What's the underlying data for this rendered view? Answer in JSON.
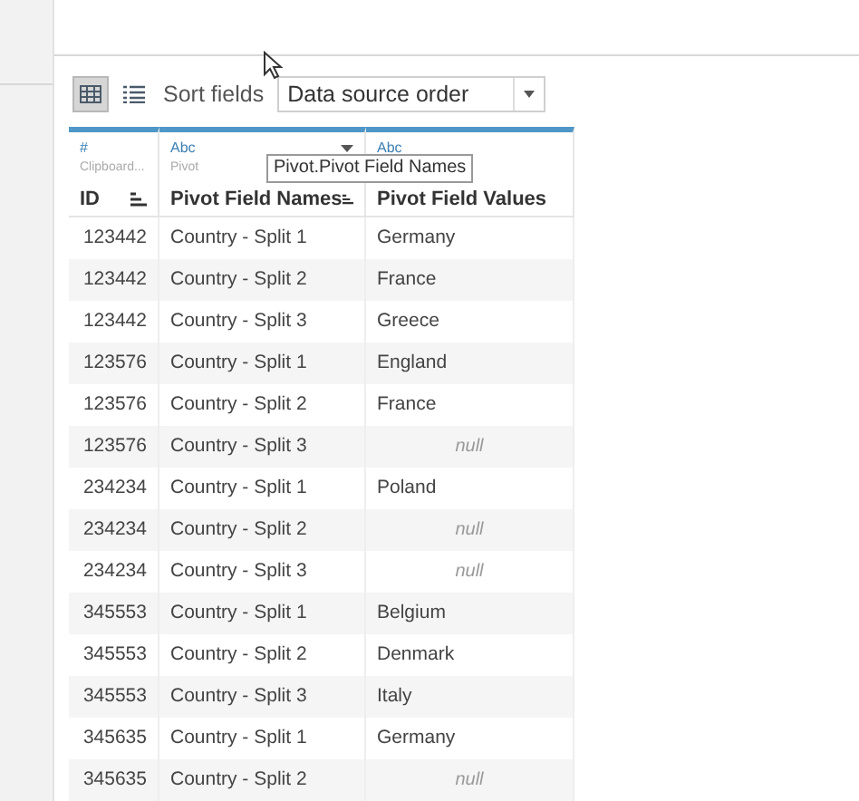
{
  "toolbar": {
    "views": [
      {
        "kind": "grid",
        "selected": true
      },
      {
        "kind": "list",
        "selected": false
      }
    ],
    "sort_label": "Sort fields",
    "sort_value": "Data source order"
  },
  "columns": [
    {
      "type_label": "#",
      "source": "Clipboard...",
      "name": "ID",
      "sort_button": true,
      "menu_caret": false
    },
    {
      "type_label": "Abc",
      "source": "Pivot",
      "name": "Pivot Field Names",
      "sort_button": true,
      "menu_caret": true
    },
    {
      "type_label": "Abc",
      "name": "Pivot Field Values",
      "sort_button": false,
      "menu_caret": false
    }
  ],
  "tooltip": "Pivot.Pivot Field Names",
  "rows": [
    {
      "id": "123442",
      "name": "Country - Split 1",
      "value": {
        "kind": "text",
        "text": "Germany"
      }
    },
    {
      "id": "123442",
      "name": "Country - Split 2",
      "value": {
        "kind": "text",
        "text": "France"
      }
    },
    {
      "id": "123442",
      "name": "Country - Split 3",
      "value": {
        "kind": "text",
        "text": "Greece"
      }
    },
    {
      "id": "123576",
      "name": "Country - Split 1",
      "value": {
        "kind": "text",
        "text": "England"
      }
    },
    {
      "id": "123576",
      "name": "Country - Split 2",
      "value": {
        "kind": "text",
        "text": "France"
      }
    },
    {
      "id": "123576",
      "name": "Country - Split 3",
      "value": {
        "kind": "null",
        "text": "null"
      }
    },
    {
      "id": "234234",
      "name": "Country - Split 1",
      "value": {
        "kind": "text",
        "text": "Poland"
      }
    },
    {
      "id": "234234",
      "name": "Country - Split 2",
      "value": {
        "kind": "null",
        "text": "null"
      }
    },
    {
      "id": "234234",
      "name": "Country - Split 3",
      "value": {
        "kind": "null",
        "text": "null"
      }
    },
    {
      "id": "345553",
      "name": "Country - Split 1",
      "value": {
        "kind": "text",
        "text": "Belgium"
      }
    },
    {
      "id": "345553",
      "name": "Country - Split 2",
      "value": {
        "kind": "text",
        "text": "Denmark"
      }
    },
    {
      "id": "345553",
      "name": "Country - Split 3",
      "value": {
        "kind": "text",
        "text": "Italy"
      }
    },
    {
      "id": "345635",
      "name": "Country - Split 1",
      "value": {
        "kind": "text",
        "text": "Germany"
      }
    },
    {
      "id": "345635",
      "name": "Country - Split 2",
      "value": {
        "kind": "null",
        "text": "null"
      }
    }
  ]
}
